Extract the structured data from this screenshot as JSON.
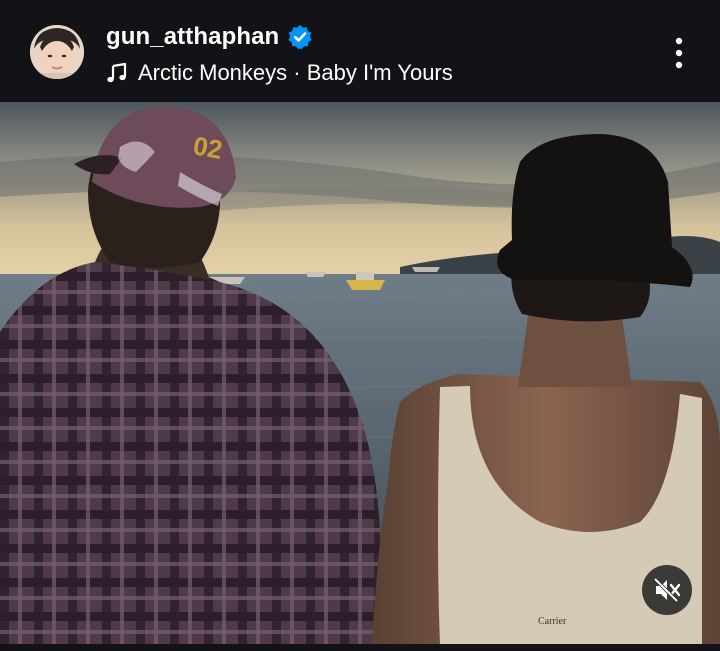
{
  "post": {
    "username": "gun_atthaphan",
    "verified": true,
    "music": {
      "icon": "music-note-icon",
      "artist_and_song": "Arctic Monkeys · Baby I'm Yours"
    }
  },
  "media": {
    "type": "video",
    "description_icon": "mute-icon",
    "cap_lettering": "02",
    "shirt_lettering": "Carrier"
  },
  "colors": {
    "header_bg": "#121217",
    "verified_blue": "#0095f6",
    "text": "#ffffff"
  }
}
